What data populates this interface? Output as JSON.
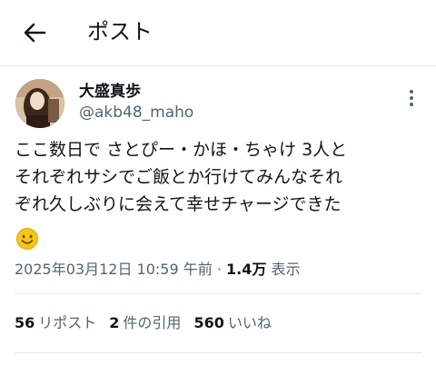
{
  "header": {
    "title": "ポスト",
    "back_icon": "arrow-left-icon"
  },
  "author": {
    "display_name": "大盛真歩",
    "handle": "@akb48_maho"
  },
  "post": {
    "lines": [
      "ここ数日で さとぴー・かほ・ちゃけ 3人と",
      "それぞれサシでご飯とか行けてみんなそれ",
      "ぞれ久しぶりに会えて幸せチャージできた"
    ],
    "emoji": "smiling-face-icon"
  },
  "meta": {
    "timestamp": "2025年03月12日 10:59 午前",
    "separator": " · ",
    "views_count": "1.4万",
    "views_label": "表示"
  },
  "stats": {
    "reposts_count": "56",
    "reposts_label": "リポスト",
    "quotes_count": "2",
    "quotes_label": "件の引用",
    "likes_count": "560",
    "likes_label": "いいね"
  },
  "colors": {
    "text_primary": "#0f1419",
    "text_secondary": "#536471",
    "divider": "#e3e6e9",
    "emoji_yellow": "#f5c518"
  }
}
